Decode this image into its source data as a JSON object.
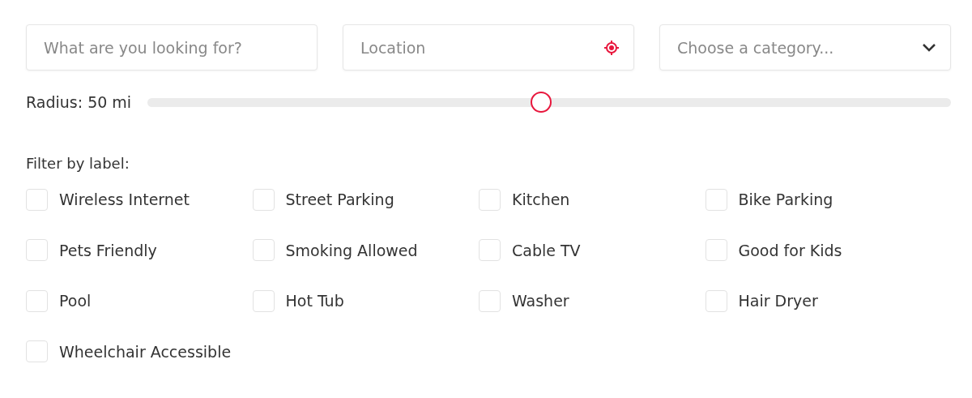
{
  "search": {
    "placeholder": "What are you looking for?"
  },
  "location": {
    "placeholder": "Location"
  },
  "category": {
    "placeholder": "Choose a category..."
  },
  "radius": {
    "label": "Radius: 50 mi",
    "level": 0.49
  },
  "filter": {
    "title": "Filter by label:",
    "labels": [
      {
        "label": "Wireless Internet",
        "checked": false
      },
      {
        "label": "Street Parking",
        "checked": false
      },
      {
        "label": "Kitchen",
        "checked": false
      },
      {
        "label": "Bike Parking",
        "checked": false
      },
      {
        "label": "Pets Friendly",
        "checked": false
      },
      {
        "label": "Smoking Allowed",
        "checked": false
      },
      {
        "label": "Cable TV",
        "checked": false
      },
      {
        "label": "Good for Kids",
        "checked": false
      },
      {
        "label": "Pool",
        "checked": false
      },
      {
        "label": "Hot Tub",
        "checked": false
      },
      {
        "label": "Washer",
        "checked": false
      },
      {
        "label": "Hair Dryer",
        "checked": false
      },
      {
        "label": "Wheelchair Accessible",
        "checked": false
      }
    ]
  }
}
